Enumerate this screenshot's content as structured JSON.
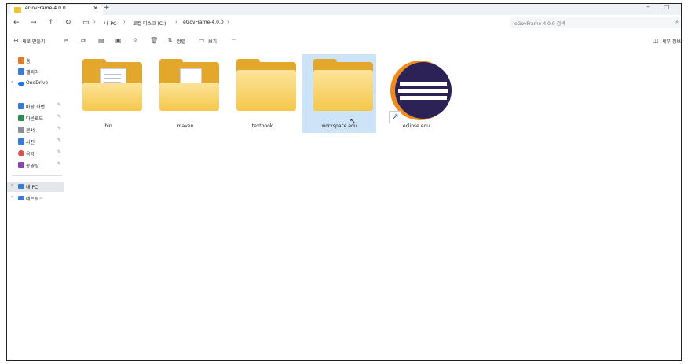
{
  "window": {
    "tab_title": "eGovFrame-4.0.0",
    "tab_close": "✕",
    "new_tab": "+",
    "minimize": "–",
    "maximize": "□"
  },
  "addressbar": {
    "back": "←",
    "forward": "→",
    "up": "↑",
    "refresh": "↻",
    "breadcrumbs": [
      "내 PC",
      "로컬 디스크 (C:)",
      "eGovFrame-4.0.0"
    ],
    "search_placeholder": "eGovFrame-4.0.0 검색"
  },
  "toolbar": {
    "new_label": "새로 만들기",
    "sort_label": "정렬",
    "view_label": "보기",
    "more_label": "···",
    "details_label": "세부 정보"
  },
  "sidebar": {
    "items": [
      {
        "label": "홈",
        "icon": "home-icon",
        "color": "#e07b2a"
      },
      {
        "label": "갤러리",
        "icon": "gallery-icon",
        "color": "#3a7bd5"
      },
      {
        "label": "OneDrive",
        "icon": "cloud-icon",
        "color": "#1a73e8"
      },
      {
        "label": "바탕 화면",
        "icon": "desktop-icon",
        "color": "#3a7bd5"
      },
      {
        "label": "다운로드",
        "icon": "download-icon",
        "color": "#2e8b57"
      },
      {
        "label": "문서",
        "icon": "document-icon",
        "color": "#8a8f98"
      },
      {
        "label": "사진",
        "icon": "pictures-icon",
        "color": "#3a7bd5"
      },
      {
        "label": "음악",
        "icon": "music-icon",
        "color": "#d9534f"
      },
      {
        "label": "동영상",
        "icon": "video-icon",
        "color": "#8e44ad"
      },
      {
        "label": "내 PC",
        "icon": "pc-icon",
        "color": "#3a7bd5"
      },
      {
        "label": "네트워크",
        "icon": "network-icon",
        "color": "#3a7bd5"
      }
    ]
  },
  "content": {
    "items": [
      {
        "name": "bin",
        "type": "folder-with-files"
      },
      {
        "name": "maven",
        "type": "folder-with-file"
      },
      {
        "name": "textbook",
        "type": "folder"
      },
      {
        "name": "workspace.edu",
        "type": "folder",
        "selected": true
      },
      {
        "name": "eclipse.edu",
        "type": "shortcut"
      }
    ]
  },
  "colors": {
    "accent": "#1565c0",
    "selection": "#cde3f7",
    "folder": "#f5c84c"
  }
}
